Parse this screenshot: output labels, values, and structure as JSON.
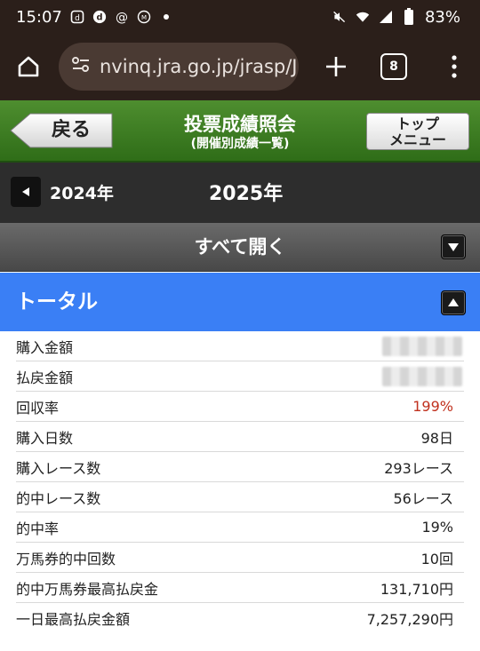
{
  "status_bar": {
    "time": "15:07",
    "battery": "83%",
    "app_icons": [
      "square-d-icon",
      "d-icon",
      "threads-icon",
      "m-icon",
      "dot-icon"
    ],
    "right_icons": [
      "mute-icon",
      "wifi-icon",
      "signal-icon",
      "battery-icon"
    ]
  },
  "browser": {
    "url": "nvinq.jra.go.jp/jrasp/JF",
    "tab_count": "8"
  },
  "header": {
    "back_label": "戻る",
    "title": "投票成績照会",
    "subtitle": "(開催別成績一覧)",
    "top_menu_line1": "トップ",
    "top_menu_line2": "メニュー"
  },
  "year_bar": {
    "prev_year": "2024年",
    "current_year": "2025年"
  },
  "open_all_label": "すべて開く",
  "section": {
    "title": "トータル",
    "rows": [
      {
        "label": "購入金額",
        "value": ""
      },
      {
        "label": "払戻金額",
        "value": ""
      },
      {
        "label": "回収率",
        "value": "199%"
      },
      {
        "label": "購入日数",
        "value": "98日"
      },
      {
        "label": "購入レース数",
        "value": "293レース"
      },
      {
        "label": "的中レース数",
        "value": "56レース"
      },
      {
        "label": "的中率",
        "value": "19%"
      },
      {
        "label": "万馬券的中回数",
        "value": "10回"
      },
      {
        "label": "的中万馬券最高払戻金",
        "value": "131,710円"
      },
      {
        "label": "一日最高払戻金額",
        "value": "7,257,290円"
      }
    ]
  },
  "colors": {
    "browser_bg": "#2b1f1a",
    "header_green": "#3d7d22",
    "section_blue": "#3a7ff5",
    "highlight_red": "#c0311e"
  }
}
